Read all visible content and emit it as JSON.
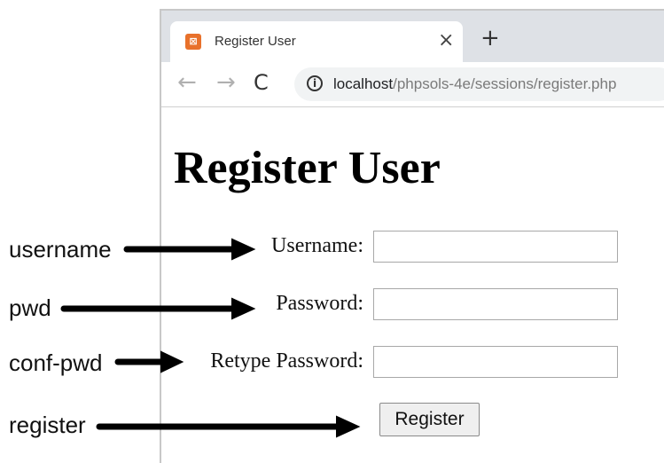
{
  "browser": {
    "tab_title": "Register User",
    "tab_close": "×",
    "new_tab": "+",
    "back": "←",
    "forward": "→",
    "reload": "C",
    "info": "i",
    "url_host": "localhost",
    "url_path": "/phpsols-4e/sessions/register.php",
    "favicon_color": "#e8712b"
  },
  "page": {
    "heading": "Register User",
    "fields": {
      "username_label": "Username:",
      "password_label": "Password:",
      "retype_label": "Retype Password:",
      "username_value": "",
      "password_value": "",
      "retype_value": ""
    },
    "submit_label": "Register"
  },
  "annotations": {
    "username": "username",
    "pwd": "pwd",
    "conf_pwd": "conf-pwd",
    "register": "register"
  }
}
